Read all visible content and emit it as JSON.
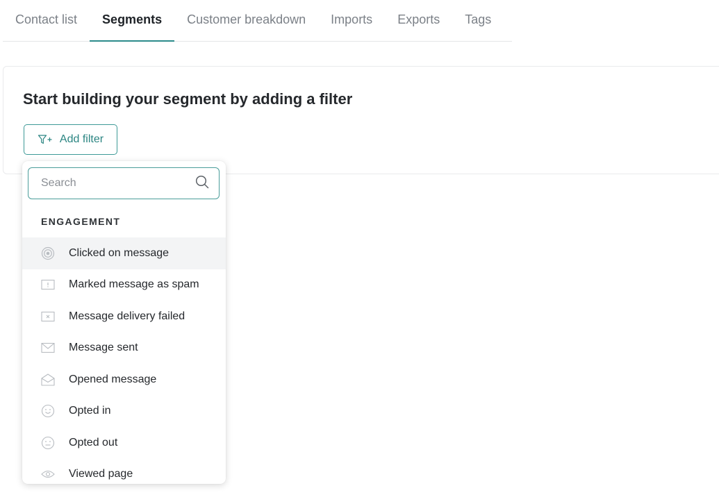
{
  "tabs": [
    {
      "label": "Contact list",
      "active": false
    },
    {
      "label": "Segments",
      "active": true
    },
    {
      "label": "Customer breakdown",
      "active": false
    },
    {
      "label": "Imports",
      "active": false
    },
    {
      "label": "Exports",
      "active": false
    },
    {
      "label": "Tags",
      "active": false
    }
  ],
  "card": {
    "title": "Start building your segment by adding a filter",
    "add_filter_label": "Add filter",
    "add_filter_icon": "filter-plus-icon"
  },
  "dropdown": {
    "search": {
      "value": "",
      "placeholder": "Search",
      "icon": "search-icon"
    },
    "section_label": "ENGAGEMENT",
    "items": [
      {
        "label": "Clicked on message",
        "icon": "target-icon"
      },
      {
        "label": "Marked message as spam",
        "icon": "spam-icon"
      },
      {
        "label": "Message delivery failed",
        "icon": "delivery-failed-icon"
      },
      {
        "label": "Message sent",
        "icon": "envelope-icon"
      },
      {
        "label": "Opened message",
        "icon": "envelope-open-icon"
      },
      {
        "label": "Opted in",
        "icon": "smile-icon"
      },
      {
        "label": "Opted out",
        "icon": "neutral-face-icon"
      },
      {
        "label": "Viewed page",
        "icon": "eye-icon"
      }
    ]
  },
  "colors": {
    "accent": "#2b8a8a",
    "text": "#25282c",
    "muted": "#7b8087",
    "hover_bg": "#f3f4f5"
  }
}
